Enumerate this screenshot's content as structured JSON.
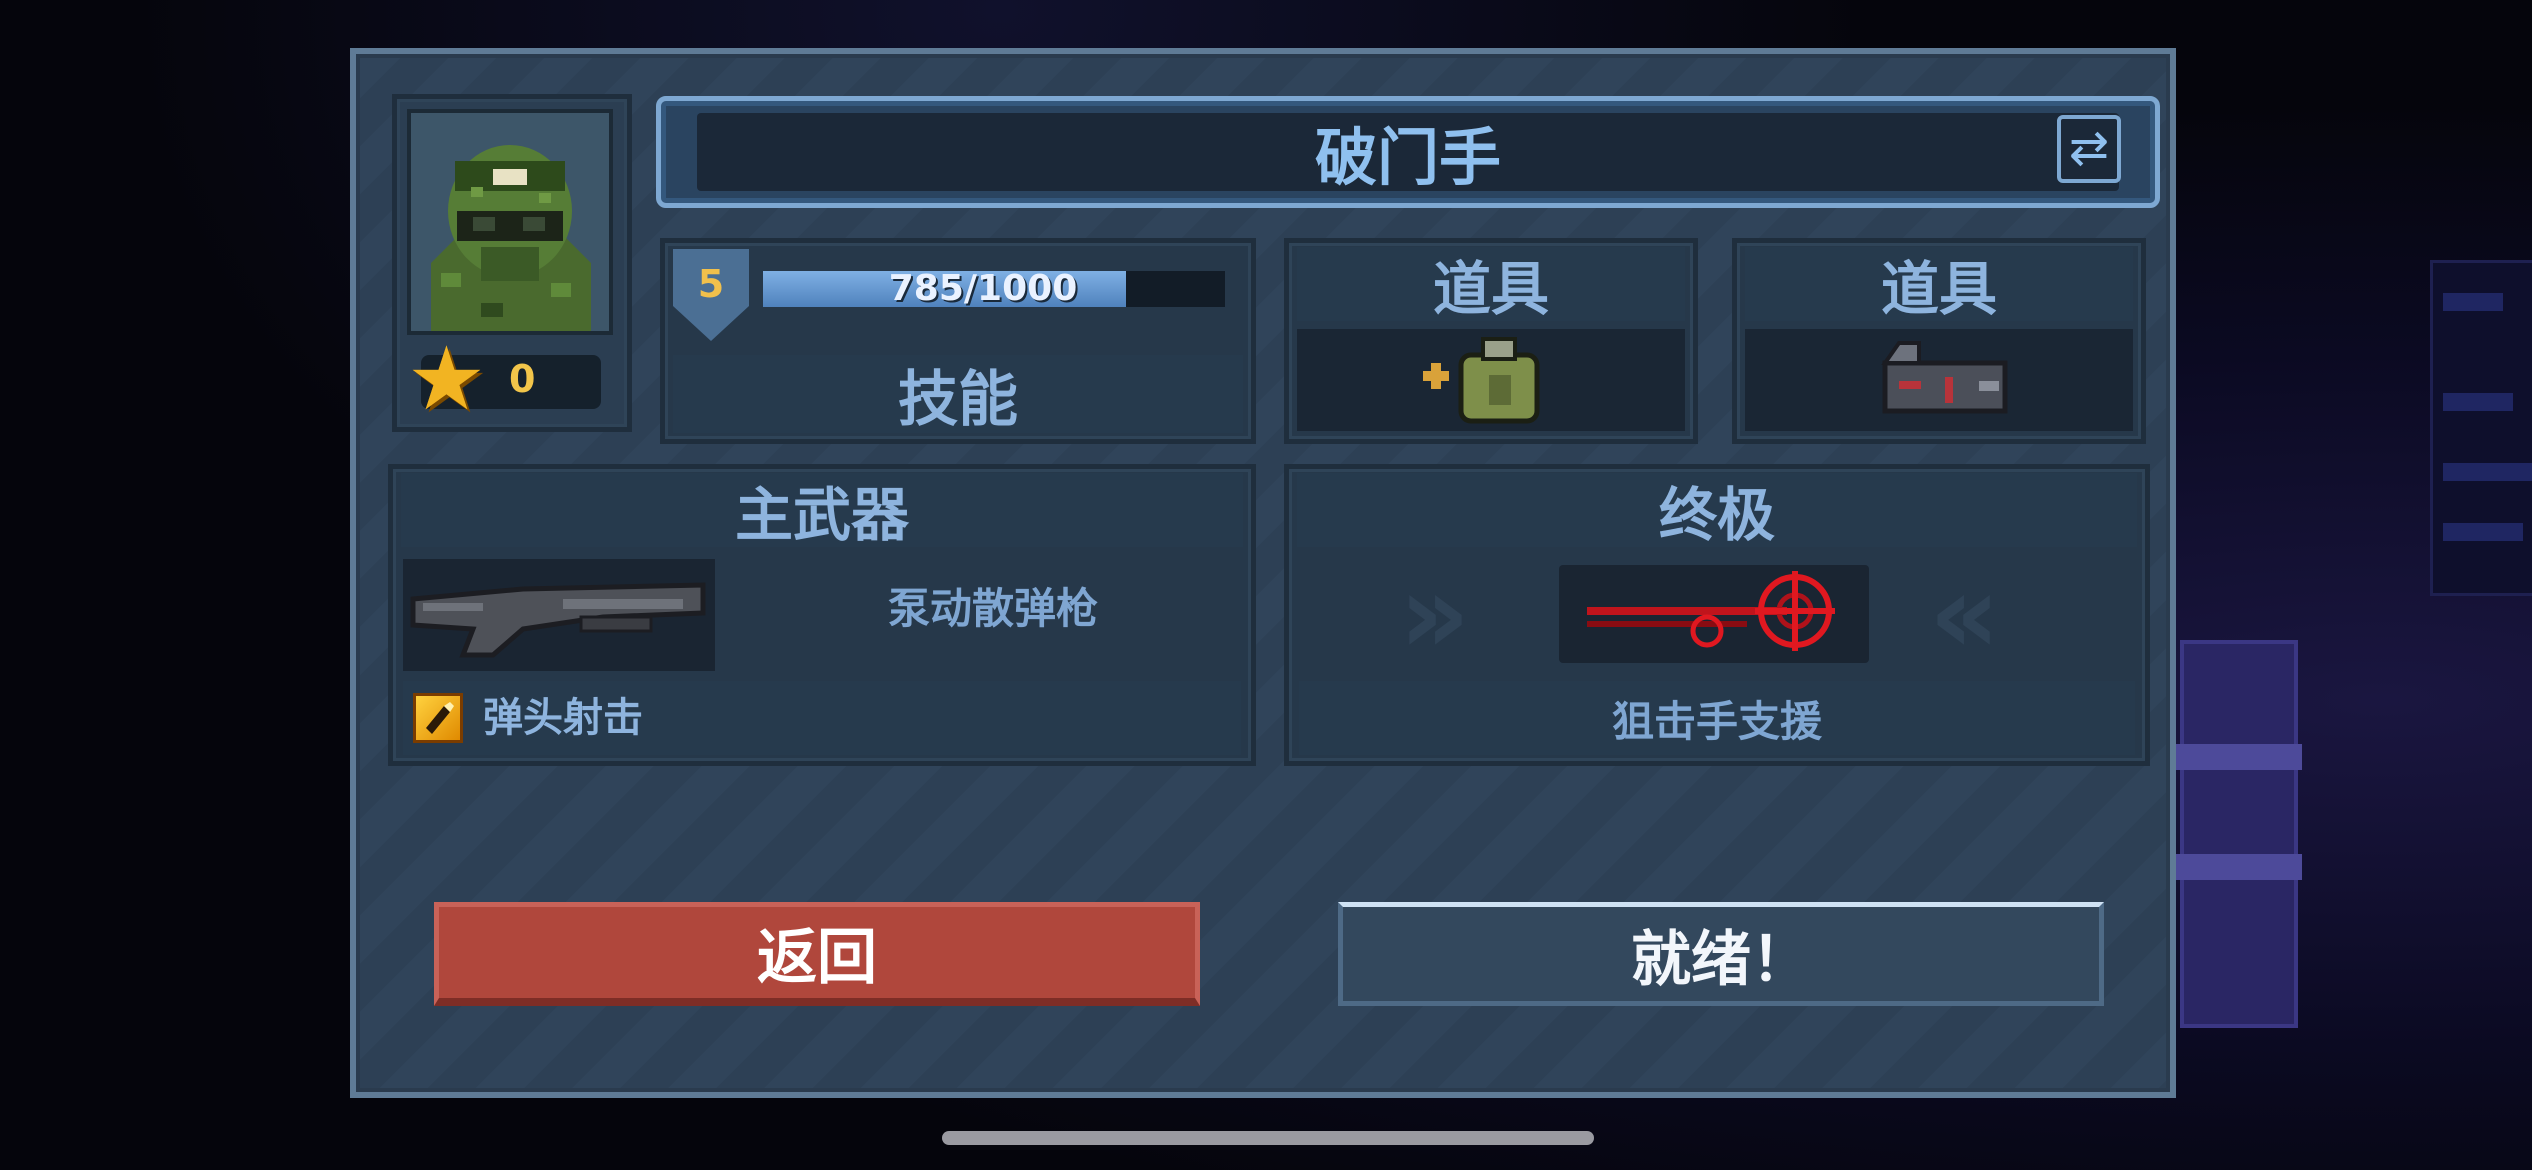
{
  "character": {
    "name": "破门手",
    "stars": "0",
    "level": "5",
    "xp_text": "785/1000",
    "xp_progress": 0.785,
    "skill_label": "技能"
  },
  "items": [
    {
      "label": "道具",
      "icon": "grenade-pack-icon"
    },
    {
      "label": "道具",
      "icon": "ammo-clip-icon"
    }
  ],
  "primary_weapon": {
    "header": "主武器",
    "name": "泵动散弹枪",
    "icon": "shotgun-icon",
    "perk": "弹头射击",
    "perk_icon": "bullet-perk-icon"
  },
  "ultimate": {
    "header": "终极",
    "name": "狙击手支援",
    "icon": "sniper-crosshair-icon"
  },
  "buttons": {
    "back": "返回",
    "ready": "就绪！"
  },
  "colors": {
    "panel": "#30445a",
    "text_accent": "#8eb4de",
    "back_button": "#b0473c",
    "ready_button": "#33485d",
    "star": "#f2b422",
    "xp_fill": "#6b9fd6"
  }
}
